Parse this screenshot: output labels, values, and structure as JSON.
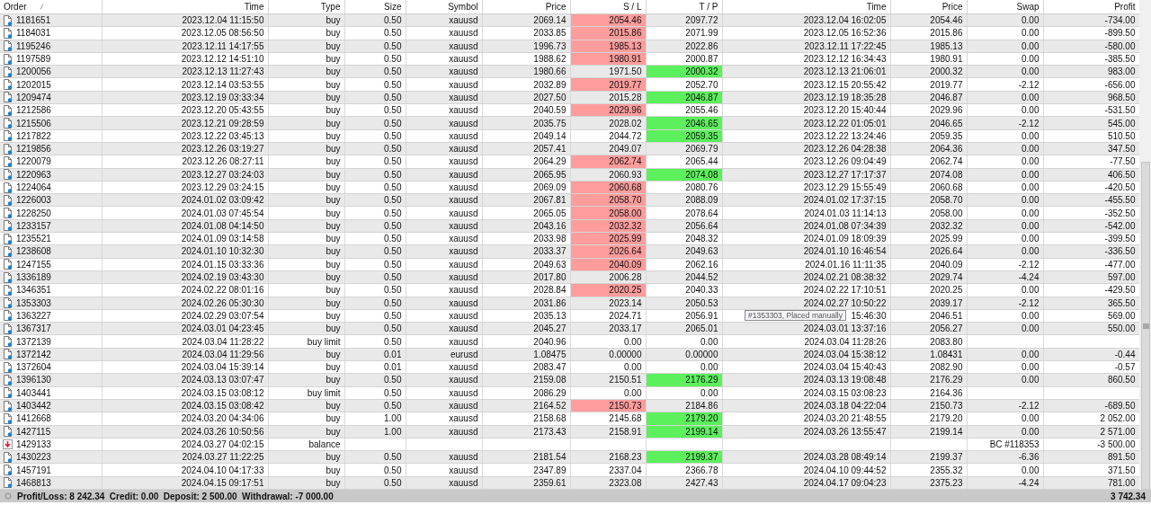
{
  "columns": [
    "Order",
    "Time",
    "Type",
    "Size",
    "Symbol",
    "Price",
    "S / L",
    "T / P",
    "Time",
    "Price",
    "Swap",
    "Profit"
  ],
  "rows": [
    {
      "kind": "trade",
      "order": "1181651",
      "time": "2023.12.04 11:15:50",
      "type": "buy",
      "size": "0.50",
      "symbol": "xauusd",
      "price": "2069.14",
      "sl": "2054.46",
      "tp": "2097.72",
      "close_time": "2023.12.04 16:02:05",
      "close_price": "2054.46",
      "swap": "0.00",
      "profit": "-734.00",
      "sl_highlight": true,
      "tp_highlight": false
    },
    {
      "kind": "trade",
      "order": "1184031",
      "time": "2023.12.05 08:56:50",
      "type": "buy",
      "size": "0.50",
      "symbol": "xauusd",
      "price": "2033.85",
      "sl": "2015.86",
      "tp": "2071.99",
      "close_time": "2023.12.05 16:52:36",
      "close_price": "2015.86",
      "swap": "0.00",
      "profit": "-899.50",
      "sl_highlight": true,
      "tp_highlight": false
    },
    {
      "kind": "trade",
      "order": "1195246",
      "time": "2023.12.11 14:17:55",
      "type": "buy",
      "size": "0.50",
      "symbol": "xauusd",
      "price": "1996.73",
      "sl": "1985.13",
      "tp": "2022.86",
      "close_time": "2023.12.11 17:22:45",
      "close_price": "1985.13",
      "swap": "0.00",
      "profit": "-580.00",
      "sl_highlight": true,
      "tp_highlight": false
    },
    {
      "kind": "trade",
      "order": "1197589",
      "time": "2023.12.12 14:51:10",
      "type": "buy",
      "size": "0.50",
      "symbol": "xauusd",
      "price": "1988.62",
      "sl": "1980.91",
      "tp": "2000.87",
      "close_time": "2023.12.12 16:34:43",
      "close_price": "1980.91",
      "swap": "0.00",
      "profit": "-385.50",
      "sl_highlight": true,
      "tp_highlight": false
    },
    {
      "kind": "trade",
      "order": "1200056",
      "time": "2023.12.13 11:27:43",
      "type": "buy",
      "size": "0.50",
      "symbol": "xauusd",
      "price": "1980.66",
      "sl": "1971.50",
      "tp": "2000.32",
      "close_time": "2023.12.13 21:06:01",
      "close_price": "2000.32",
      "swap": "0.00",
      "profit": "983.00",
      "sl_highlight": false,
      "tp_highlight": true
    },
    {
      "kind": "trade",
      "order": "1202015",
      "time": "2023.12.14 03:53:55",
      "type": "buy",
      "size": "0.50",
      "symbol": "xauusd",
      "price": "2032.89",
      "sl": "2019.77",
      "tp": "2052.70",
      "close_time": "2023.12.15 20:55:42",
      "close_price": "2019.77",
      "swap": "-2.12",
      "profit": "-656.00",
      "sl_highlight": true,
      "tp_highlight": false
    },
    {
      "kind": "trade",
      "order": "1209474",
      "time": "2023.12.19 03:33:34",
      "type": "buy",
      "size": "0.50",
      "symbol": "xauusd",
      "price": "2027.50",
      "sl": "2015.28",
      "tp": "2046.87",
      "close_time": "2023.12.19 18:35:28",
      "close_price": "2046.87",
      "swap": "0.00",
      "profit": "968.50",
      "sl_highlight": false,
      "tp_highlight": true
    },
    {
      "kind": "trade",
      "order": "1212586",
      "time": "2023.12.20 05:43:55",
      "type": "buy",
      "size": "0.50",
      "symbol": "xauusd",
      "price": "2040.59",
      "sl": "2029.96",
      "tp": "2055.46",
      "close_time": "2023.12.20 15:40:44",
      "close_price": "2029.96",
      "swap": "0.00",
      "profit": "-531.50",
      "sl_highlight": true,
      "tp_highlight": false
    },
    {
      "kind": "trade",
      "order": "1215506",
      "time": "2023.12.21 09:28:59",
      "type": "buy",
      "size": "0.50",
      "symbol": "xauusd",
      "price": "2035.75",
      "sl": "2028.02",
      "tp": "2046.65",
      "close_time": "2023.12.22 01:05:01",
      "close_price": "2046.65",
      "swap": "-2.12",
      "profit": "545.00",
      "sl_highlight": false,
      "tp_highlight": true
    },
    {
      "kind": "trade",
      "order": "1217822",
      "time": "2023.12.22 03:45:13",
      "type": "buy",
      "size": "0.50",
      "symbol": "xauusd",
      "price": "2049.14",
      "sl": "2044.72",
      "tp": "2059.35",
      "close_time": "2023.12.22 13:24:46",
      "close_price": "2059.35",
      "swap": "0.00",
      "profit": "510.50",
      "sl_highlight": false,
      "tp_highlight": true
    },
    {
      "kind": "trade",
      "order": "1219856",
      "time": "2023.12.26 03:19:27",
      "type": "buy",
      "size": "0.50",
      "symbol": "xauusd",
      "price": "2057.41",
      "sl": "2049.07",
      "tp": "2069.79",
      "close_time": "2023.12.26 04:28:38",
      "close_price": "2064.36",
      "swap": "0.00",
      "profit": "347.50",
      "sl_highlight": false,
      "tp_highlight": false
    },
    {
      "kind": "trade",
      "order": "1220079",
      "time": "2023.12.26 08:27:11",
      "type": "buy",
      "size": "0.50",
      "symbol": "xauusd",
      "price": "2064.29",
      "sl": "2062.74",
      "tp": "2065.44",
      "close_time": "2023.12.26 09:04:49",
      "close_price": "2062.74",
      "swap": "0.00",
      "profit": "-77.50",
      "sl_highlight": true,
      "tp_highlight": false
    },
    {
      "kind": "trade",
      "order": "1220963",
      "time": "2023.12.27 03:24:03",
      "type": "buy",
      "size": "0.50",
      "symbol": "xauusd",
      "price": "2065.95",
      "sl": "2060.93",
      "tp": "2074.08",
      "close_time": "2023.12.27 17:17:37",
      "close_price": "2074.08",
      "swap": "0.00",
      "profit": "406.50",
      "sl_highlight": false,
      "tp_highlight": true
    },
    {
      "kind": "trade",
      "order": "1224064",
      "time": "2023.12.29 03:24:15",
      "type": "buy",
      "size": "0.50",
      "symbol": "xauusd",
      "price": "2069.09",
      "sl": "2060.68",
      "tp": "2080.76",
      "close_time": "2023.12.29 15:55:49",
      "close_price": "2060.68",
      "swap": "0.00",
      "profit": "-420.50",
      "sl_highlight": true,
      "tp_highlight": false
    },
    {
      "kind": "trade",
      "order": "1226003",
      "time": "2024.01.02 03:09:42",
      "type": "buy",
      "size": "0.50",
      "symbol": "xauusd",
      "price": "2067.81",
      "sl": "2058.70",
      "tp": "2088.09",
      "close_time": "2024.01.02 17:37:15",
      "close_price": "2058.70",
      "swap": "0.00",
      "profit": "-455.50",
      "sl_highlight": true,
      "tp_highlight": false
    },
    {
      "kind": "trade",
      "order": "1228250",
      "time": "2024.01.03 07:45:54",
      "type": "buy",
      "size": "0.50",
      "symbol": "xauusd",
      "price": "2065.05",
      "sl": "2058.00",
      "tp": "2078.64",
      "close_time": "2024.01.03 11:14:13",
      "close_price": "2058.00",
      "swap": "0.00",
      "profit": "-352.50",
      "sl_highlight": true,
      "tp_highlight": false
    },
    {
      "kind": "trade",
      "order": "1233157",
      "time": "2024.01.08 04:14:50",
      "type": "buy",
      "size": "0.50",
      "symbol": "xauusd",
      "price": "2043.16",
      "sl": "2032.32",
      "tp": "2056.64",
      "close_time": "2024.01.08 07:34:39",
      "close_price": "2032.32",
      "swap": "0.00",
      "profit": "-542.00",
      "sl_highlight": true,
      "tp_highlight": false
    },
    {
      "kind": "trade",
      "order": "1235521",
      "time": "2024.01.09 03:14:58",
      "type": "buy",
      "size": "0.50",
      "symbol": "xauusd",
      "price": "2033.98",
      "sl": "2025.99",
      "tp": "2048.32",
      "close_time": "2024.01.09 18:09:39",
      "close_price": "2025.99",
      "swap": "0.00",
      "profit": "-399.50",
      "sl_highlight": true,
      "tp_highlight": false
    },
    {
      "kind": "trade",
      "order": "1238608",
      "time": "2024.01.10 10:32:30",
      "type": "buy",
      "size": "0.50",
      "symbol": "xauusd",
      "price": "2033.37",
      "sl": "2026.64",
      "tp": "2049.63",
      "close_time": "2024.01.10 16:46:54",
      "close_price": "2026.64",
      "swap": "0.00",
      "profit": "-336.50",
      "sl_highlight": true,
      "tp_highlight": false
    },
    {
      "kind": "trade",
      "order": "1247155",
      "time": "2024.01.15 03:33:36",
      "type": "buy",
      "size": "0.50",
      "symbol": "xauusd",
      "price": "2049.63",
      "sl": "2040.09",
      "tp": "2062.16",
      "close_time": "2024.01.16 11:11:35",
      "close_price": "2040.09",
      "swap": "-2.12",
      "profit": "-477.00",
      "sl_highlight": true,
      "tp_highlight": false
    },
    {
      "kind": "trade",
      "order": "1336189",
      "time": "2024.02.19 03:43:30",
      "type": "buy",
      "size": "0.50",
      "symbol": "xauusd",
      "price": "2017.80",
      "sl": "2006.28",
      "tp": "2044.52",
      "close_time": "2024.02.21 08:38:32",
      "close_price": "2029.74",
      "swap": "-4.24",
      "profit": "597.00",
      "sl_highlight": false,
      "tp_highlight": false
    },
    {
      "kind": "trade",
      "order": "1346351",
      "time": "2024.02.22 08:01:16",
      "type": "buy",
      "size": "0.50",
      "symbol": "xauusd",
      "price": "2028.84",
      "sl": "2020.25",
      "tp": "2040.33",
      "close_time": "2024.02.22 17:10:51",
      "close_price": "2020.25",
      "swap": "0.00",
      "profit": "-429.50",
      "sl_highlight": true,
      "tp_highlight": false
    },
    {
      "kind": "trade",
      "order": "1353303",
      "time": "2024.02.26 05:30:30",
      "type": "buy",
      "size": "0.50",
      "symbol": "xauusd",
      "price": "2031.86",
      "sl": "2023.14",
      "tp": "2050.53",
      "close_time": "2024.02.27 10:50:22",
      "close_price": "2039.17",
      "swap": "-2.12",
      "profit": "365.50",
      "sl_highlight": false,
      "tp_highlight": false
    },
    {
      "kind": "trade",
      "order": "1363227",
      "time": "2024.02.29 03:07:54",
      "type": "buy",
      "size": "0.50",
      "symbol": "xauusd",
      "price": "2035.13",
      "sl": "2024.71",
      "tp": "2056.91",
      "close_time": "15:46:30",
      "close_price": "2046.51",
      "swap": "0.00",
      "profit": "569.00",
      "sl_highlight": false,
      "tp_highlight": false
    },
    {
      "kind": "trade",
      "order": "1367317",
      "time": "2024.03.01 04:23:45",
      "type": "buy",
      "size": "0.50",
      "symbol": "xauusd",
      "price": "2045.27",
      "sl": "2033.17",
      "tp": "2065.01",
      "close_time": "2024.03.01 13:37:16",
      "close_price": "2056.27",
      "swap": "0.00",
      "profit": "550.00",
      "sl_highlight": false,
      "tp_highlight": false
    },
    {
      "kind": "trade",
      "order": "1372139",
      "time": "2024.03.04 11:28:22",
      "type": "buy limit",
      "size": "0.50",
      "symbol": "xauusd",
      "price": "2040.96",
      "sl": "0.00",
      "tp": "0.00",
      "close_time": "2024.03.04 11:28:26",
      "close_price": "2083.80",
      "sl_highlight": false,
      "tp_highlight": false
    },
    {
      "kind": "trade",
      "order": "1372142",
      "time": "2024.03.04 11:29:56",
      "type": "buy",
      "size": "0.01",
      "symbol": "eurusd",
      "price": "1.08475",
      "sl": "0.00000",
      "tp": "0.00000",
      "close_time": "2024.03.04 15:38:12",
      "close_price": "1.08431",
      "swap": "0.00",
      "profit": "-0.44",
      "sl_highlight": false,
      "tp_highlight": false
    },
    {
      "kind": "trade",
      "order": "1372604",
      "time": "2024.03.04 15:39:14",
      "type": "buy",
      "size": "0.01",
      "symbol": "xauusd",
      "price": "2083.47",
      "sl": "0.00",
      "tp": "0.00",
      "close_time": "2024.03.04 15:40:43",
      "close_price": "2082.90",
      "swap": "0.00",
      "profit": "-0.57",
      "sl_highlight": false,
      "tp_highlight": false
    },
    {
      "kind": "trade",
      "order": "1396130",
      "time": "2024.03.13 03:07:47",
      "type": "buy",
      "size": "0.50",
      "symbol": "xauusd",
      "price": "2159.08",
      "sl": "2150.51",
      "tp": "2176.29",
      "close_time": "2024.03.13 19:08:48",
      "close_price": "2176.29",
      "swap": "0.00",
      "profit": "860.50",
      "sl_highlight": false,
      "tp_highlight": true
    },
    {
      "kind": "trade",
      "order": "1403441",
      "time": "2024.03.15 03:08:12",
      "type": "buy limit",
      "size": "0.50",
      "symbol": "xauusd",
      "price": "2086.29",
      "sl": "0.00",
      "tp": "0.00",
      "close_time": "2024.03.15 03:08:23",
      "close_price": "2164.36",
      "sl_highlight": false,
      "tp_highlight": false
    },
    {
      "kind": "trade",
      "order": "1403442",
      "time": "2024.03.15 03:08:42",
      "type": "buy",
      "size": "0.50",
      "symbol": "xauusd",
      "price": "2164.52",
      "sl": "2150.73",
      "tp": "2184.86",
      "close_time": "2024.03.18 04:22:04",
      "close_price": "2150.73",
      "swap": "-2.12",
      "profit": "-689.50",
      "sl_highlight": true,
      "tp_highlight": false
    },
    {
      "kind": "trade",
      "order": "1412668",
      "time": "2024.03.20 04:34:06",
      "type": "buy",
      "size": "1.00",
      "symbol": "xauusd",
      "price": "2158.68",
      "sl": "2145.68",
      "tp": "2179.20",
      "close_time": "2024.03.20 21:48:55",
      "close_price": "2179.20",
      "swap": "0.00",
      "profit": "2 052.00",
      "sl_highlight": false,
      "tp_highlight": true
    },
    {
      "kind": "trade",
      "order": "1427115",
      "time": "2024.03.26 10:50:56",
      "type": "buy",
      "size": "1.00",
      "symbol": "xauusd",
      "price": "2173.43",
      "sl": "2158.91",
      "tp": "2199.14",
      "close_time": "2024.03.26 13:55:47",
      "close_price": "2199.14",
      "swap": "0.00",
      "profit": "2 571.00",
      "sl_highlight": false,
      "tp_highlight": true
    },
    {
      "kind": "balance",
      "order": "1429133",
      "time": "2024.03.27 04:02:15",
      "type": "balance",
      "comment": "BC #118353",
      "profit": "-3 500.00"
    },
    {
      "kind": "trade",
      "order": "1430223",
      "time": "2024.03.27 11:22:25",
      "type": "buy",
      "size": "0.50",
      "symbol": "xauusd",
      "price": "2181.54",
      "sl": "2168.23",
      "tp": "2199.37",
      "close_time": "2024.03.28 08:49:14",
      "close_price": "2199.37",
      "swap": "-6.36",
      "profit": "891.50",
      "sl_highlight": false,
      "tp_highlight": true
    },
    {
      "kind": "trade",
      "order": "1457191",
      "time": "2024.04.10 04:17:33",
      "type": "buy",
      "size": "0.50",
      "symbol": "xauusd",
      "price": "2347.89",
      "sl": "2337.04",
      "tp": "2366.78",
      "close_time": "2024.04.10 09:44:52",
      "close_price": "2355.32",
      "swap": "0.00",
      "profit": "371.50",
      "sl_highlight": false,
      "tp_highlight": false
    },
    {
      "kind": "trade",
      "order": "1468813",
      "time": "2024.04.15 09:17:51",
      "type": "buy",
      "size": "0.50",
      "symbol": "xauusd",
      "price": "2359.61",
      "sl": "2323.08",
      "tp": "2427.43",
      "close_time": "2024.04.17 09:04:23",
      "close_price": "2375.23",
      "swap": "-4.24",
      "profit": "781.00",
      "sl_highlight": false,
      "tp_highlight": false
    }
  ],
  "tooltip": "#1353303, Placed manually",
  "summary": {
    "text": "Profit/Loss: 8 242.34  Credit: 0.00  Deposit: 2 500.00  Withdrawal: -7 000.00",
    "total": "3 742.34"
  }
}
